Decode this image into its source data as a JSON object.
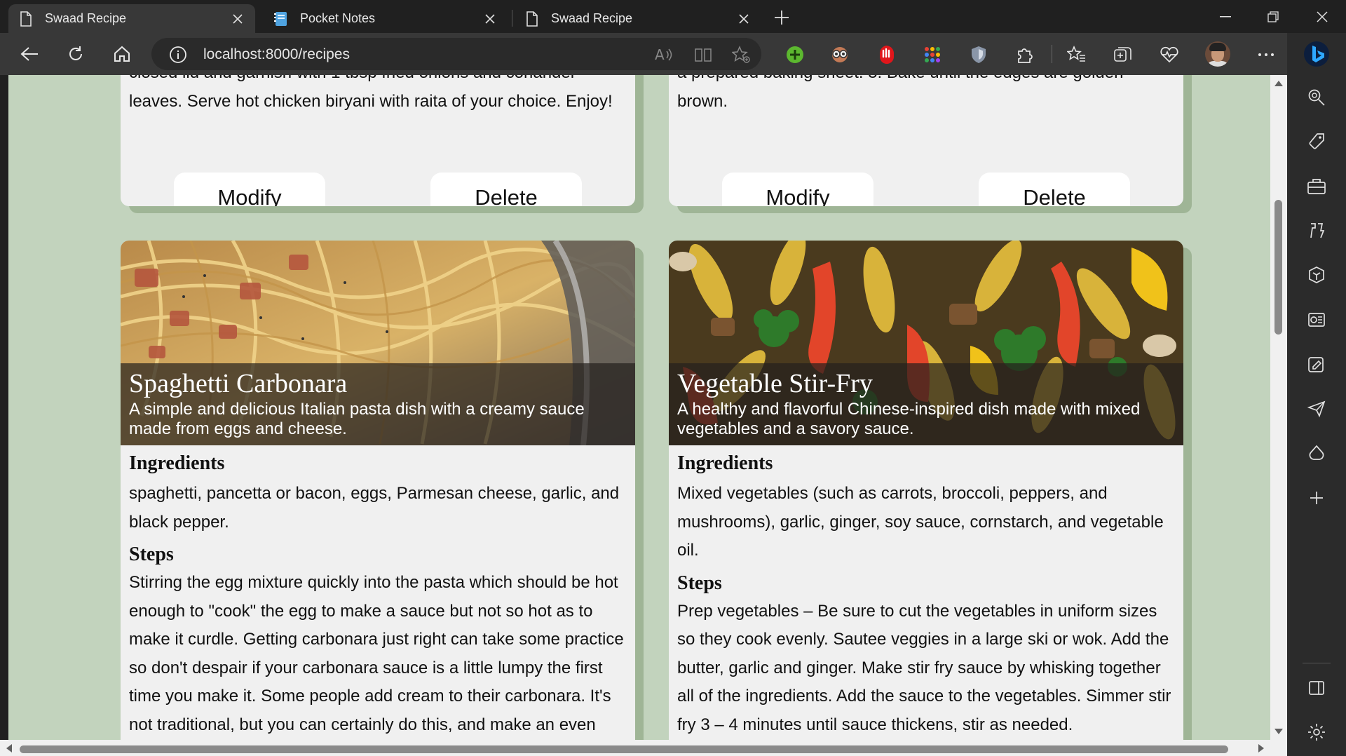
{
  "browser": {
    "tabs": [
      {
        "label": "Swaad Recipe",
        "active": true,
        "icon": "page-icon"
      },
      {
        "label": "Pocket Notes",
        "active": false,
        "icon": "notebook-icon"
      },
      {
        "label": "Swaad Recipe",
        "active": false,
        "icon": "page-icon"
      }
    ],
    "url": "localhost:8000/recipes"
  },
  "colors": {
    "page_background": "#c2d3bd",
    "card_background": "#f0f0f0",
    "card_shadow": "#9fb596",
    "button_background": "#ffffff"
  },
  "recipes_top": [
    {
      "text": "closed lid and garnish with 1 tbsp fried onions and coriander leaves. Serve hot chicken biryani with raita of your choice. Enjoy!",
      "modify_label": "Modify",
      "delete_label": "Delete"
    },
    {
      "text": "a prepared baking sheet. 5. Bake until the edges are golden brown.",
      "modify_label": "Modify",
      "delete_label": "Delete"
    }
  ],
  "recipes": [
    {
      "title": "Spaghetti Carbonara",
      "description": "A simple and delicious Italian pasta dish with a creamy sauce made from eggs and cheese.",
      "ingredients_heading": "Ingredients",
      "ingredients": "spaghetti, pancetta or bacon, eggs, Parmesan cheese, garlic, and black pepper.",
      "steps_heading": "Steps",
      "steps": "Stirring the egg mixture quickly into the pasta which should be hot enough to \"cook\" the egg to make a sauce but not so hot as to make it curdle. Getting carbonara just right can take some practice so don't despair if your carbonara sauce is a little lumpy the first time you make it. Some people add cream to their carbonara. It's not traditional, but you can certainly do this, and make an even"
    },
    {
      "title": "Vegetable Stir-Fry",
      "description": "A healthy and flavorful Chinese-inspired dish made with mixed vegetables and a savory sauce.",
      "ingredients_heading": "Ingredients",
      "ingredients": "Mixed vegetables (such as carrots, broccoli, peppers, and mushrooms), garlic, ginger, soy sauce, cornstarch, and vegetable oil.",
      "steps_heading": "Steps",
      "steps": "Prep vegetables – Be sure to cut the vegetables in uniform sizes so they cook evenly. Sautee veggies in a large ski or wok. Add the butter, garlic and ginger. Make stir fry sauce by whisking together all of the ingredients. Add the sauce to the vegetables. Simmer stir fry 3 – 4 minutes until sauce thickens, stir as needed."
    }
  ]
}
